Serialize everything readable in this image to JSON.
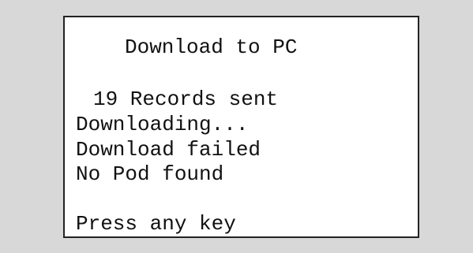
{
  "screen": {
    "title": "Download to PC",
    "records_sent": "19 Records sent",
    "status_downloading": "Downloading...",
    "status_failed": "Download failed",
    "status_no_pod": "No Pod found",
    "prompt": "Press any key"
  },
  "colors": {
    "background": "#d8d8d8",
    "screen": "#ffffff",
    "border": "#222222",
    "text": "#111111"
  }
}
